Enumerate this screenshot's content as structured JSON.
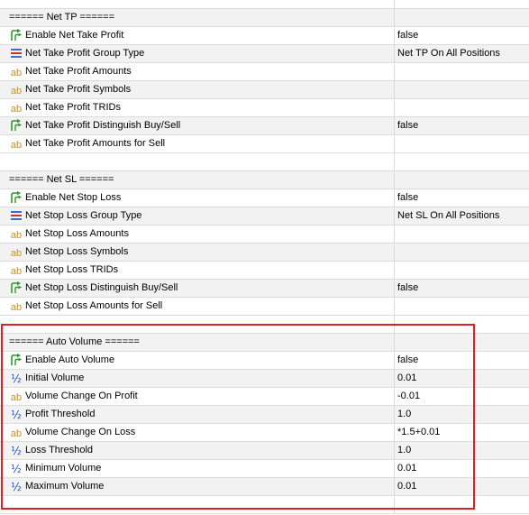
{
  "sections": [
    {
      "title": "====== Net TP ======",
      "rows": [
        {
          "icon": "toggle-arrow-icon",
          "label": "Enable Net Take Profit",
          "value": "false"
        },
        {
          "icon": "enum-list-icon",
          "label": "Net Take Profit Group Type",
          "value": "Net TP On All Positions"
        },
        {
          "icon": "string-ab-icon",
          "label": "Net Take Profit Amounts",
          "value": ""
        },
        {
          "icon": "string-ab-icon",
          "label": "Net Take Profit Symbols",
          "value": ""
        },
        {
          "icon": "string-ab-icon",
          "label": "Net Take Profit TRIDs",
          "value": ""
        },
        {
          "icon": "toggle-arrow-icon",
          "label": "Net Take Profit Distinguish Buy/Sell",
          "value": "false"
        },
        {
          "icon": "string-ab-icon",
          "label": "Net Take Profit Amounts for Sell",
          "value": ""
        }
      ]
    },
    {
      "title": "====== Net SL ======",
      "rows": [
        {
          "icon": "toggle-arrow-icon",
          "label": "Enable Net Stop Loss",
          "value": "false"
        },
        {
          "icon": "enum-list-icon",
          "label": "Net Stop Loss Group Type",
          "value": "Net SL On All Positions"
        },
        {
          "icon": "string-ab-icon",
          "label": "Net Stop Loss Amounts",
          "value": ""
        },
        {
          "icon": "string-ab-icon",
          "label": "Net Stop Loss Symbols",
          "value": ""
        },
        {
          "icon": "string-ab-icon",
          "label": "Net Stop Loss TRIDs",
          "value": ""
        },
        {
          "icon": "toggle-arrow-icon",
          "label": "Net Stop Loss Distinguish Buy/Sell",
          "value": "false"
        },
        {
          "icon": "string-ab-icon",
          "label": "Net Stop Loss Amounts for Sell",
          "value": ""
        }
      ]
    },
    {
      "title": "====== Auto Volume ======",
      "rows": [
        {
          "icon": "toggle-arrow-icon",
          "label": "Enable Auto Volume",
          "value": "false"
        },
        {
          "icon": "fraction-half-icon",
          "label": "Initial Volume",
          "value": "0.01"
        },
        {
          "icon": "string-ab-icon",
          "label": "Volume Change On Profit",
          "value": "-0.01"
        },
        {
          "icon": "fraction-half-icon",
          "label": "Profit Threshold",
          "value": "1.0"
        },
        {
          "icon": "string-ab-icon",
          "label": "Volume Change On Loss",
          "value": "*1.5+0.01"
        },
        {
          "icon": "fraction-half-icon",
          "label": "Loss Threshold",
          "value": "1.0"
        },
        {
          "icon": "fraction-half-icon",
          "label": "Minimum Volume",
          "value": "0.01"
        },
        {
          "icon": "fraction-half-icon",
          "label": "Maximum Volume",
          "value": "0.01"
        }
      ]
    }
  ],
  "icon_glyphs": {
    "string-ab-icon": "ab",
    "fraction-half-icon": "½"
  },
  "colors": {
    "highlight_border": "#e02020",
    "grid_line": "#dcdcdc",
    "alt_row": "#f2f2f2"
  }
}
